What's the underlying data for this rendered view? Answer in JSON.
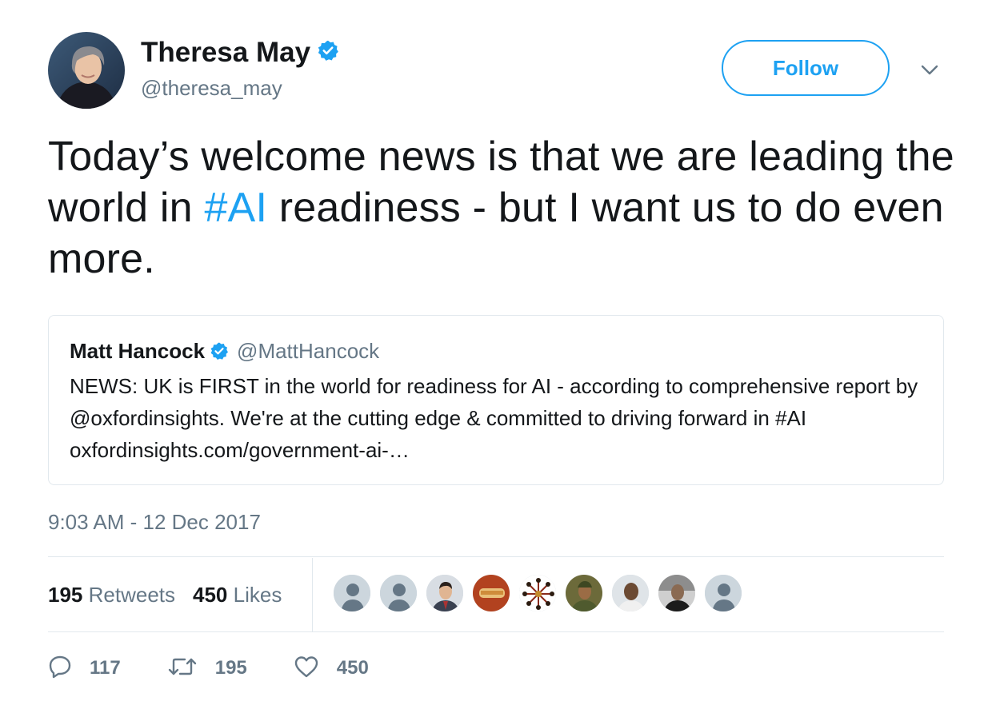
{
  "author": {
    "name": "Theresa May",
    "handle": "@theresa_may",
    "verified": true,
    "avatar_icon": "profile-photo"
  },
  "follow": {
    "label": "Follow"
  },
  "menu": {
    "icon": "chevron-down-icon"
  },
  "tweet": {
    "text_before": "Today’s welcome news is that we are leading the world in ",
    "hashtag": "#AI",
    "text_after": " readiness - but I want us to do even more."
  },
  "quoted": {
    "name": "Matt Hancock",
    "handle": "@MattHancock",
    "verified": true,
    "text": "NEWS: UK is FIRST in the world for readiness for AI - according to comprehensive report by @oxfordinsights. We're at the cutting edge & committed to driving forward in #AI oxfordinsights.com/government-ai-…"
  },
  "timestamp": "9:03 AM - 12 Dec 2017",
  "stats": {
    "retweets_count": "195",
    "retweets_label": "Retweets",
    "likes_count": "450",
    "likes_label": "Likes"
  },
  "actions": {
    "replies": "117",
    "retweets": "195",
    "likes": "450"
  },
  "colors": {
    "accent": "#1da1f2",
    "secondary_text": "#657786",
    "border": "#e1e8ed"
  }
}
